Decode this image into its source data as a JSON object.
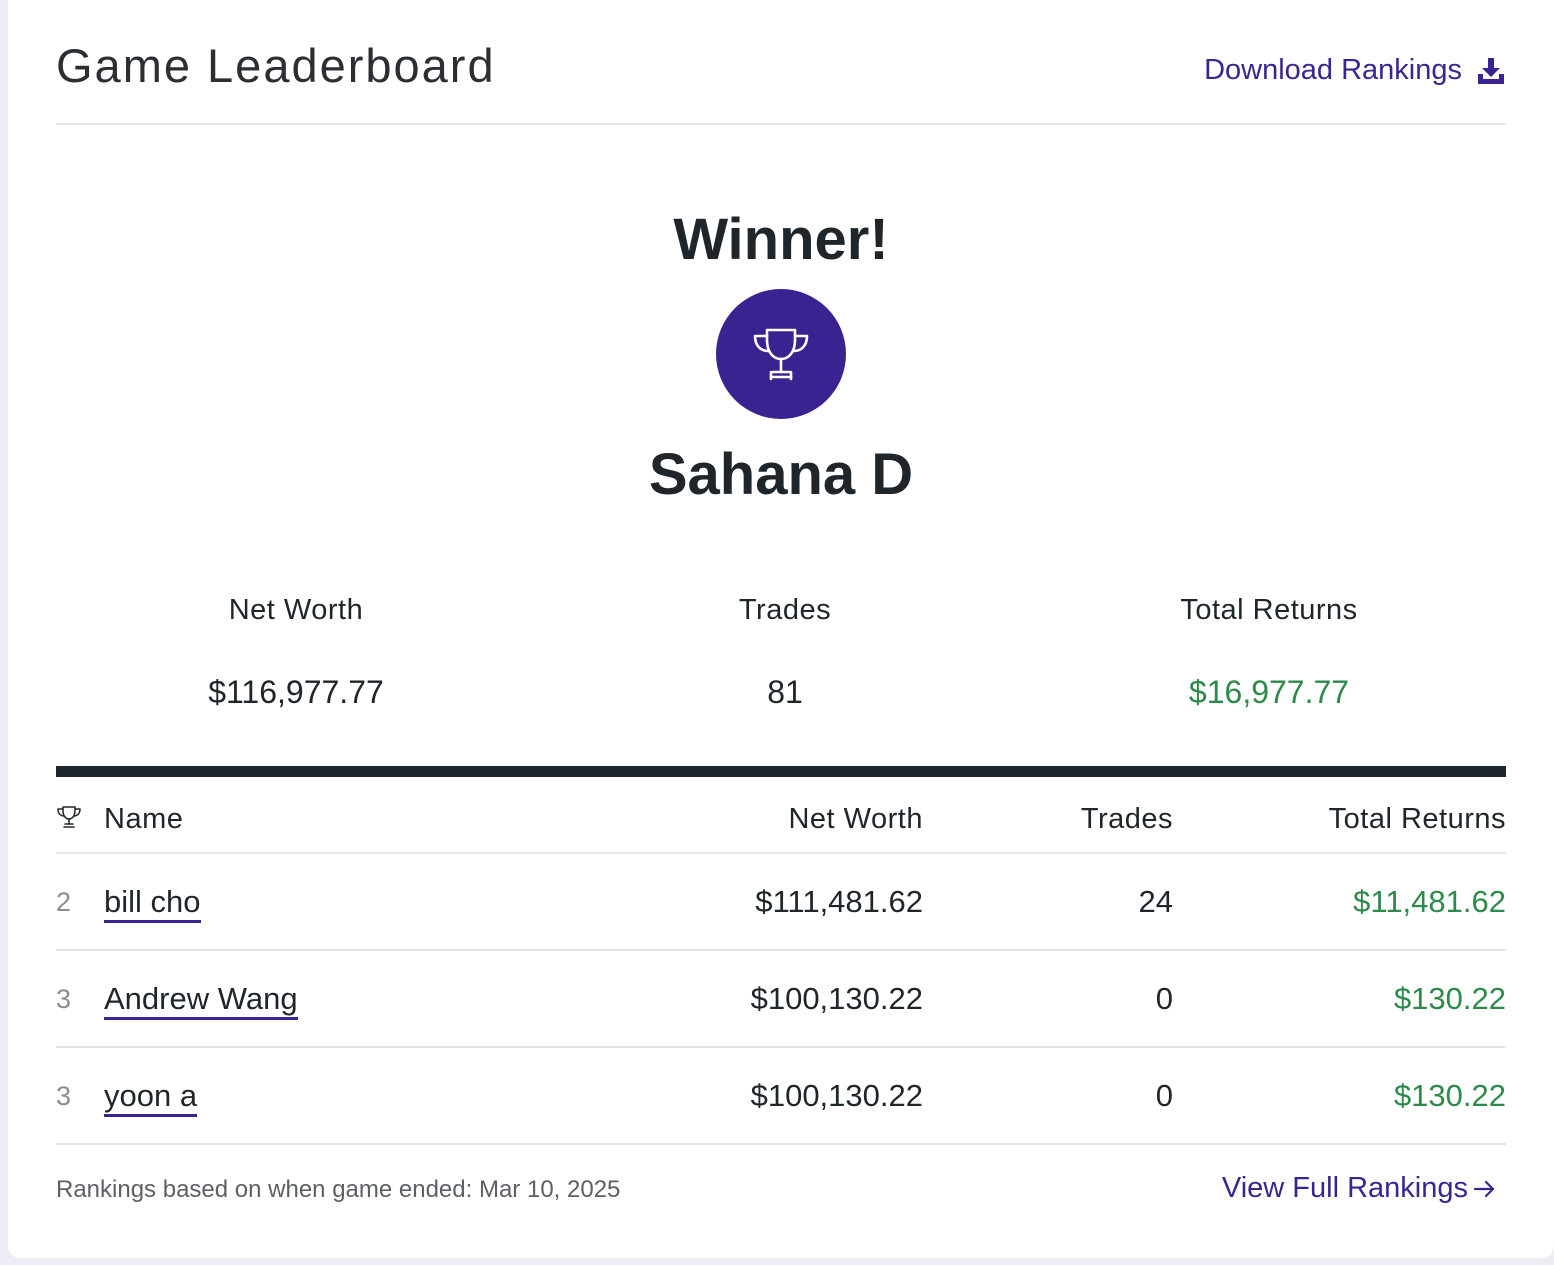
{
  "header": {
    "title": "Game Leaderboard",
    "download_label": "Download Rankings",
    "download_icon": "download-icon"
  },
  "winner": {
    "heading": "Winner!",
    "icon": "trophy-icon",
    "name": "Sahana D",
    "stats": {
      "net_worth_label": "Net Worth",
      "net_worth": "$116,977.77",
      "trades_label": "Trades",
      "trades": "81",
      "returns_label": "Total Returns",
      "returns": "$16,977.77"
    }
  },
  "table": {
    "columns": {
      "rank_icon": "trophy-icon",
      "name": "Name",
      "net_worth": "Net Worth",
      "trades": "Trades",
      "returns": "Total Returns"
    },
    "rows": [
      {
        "rank": "2",
        "name": "bill cho",
        "net_worth": "$111,481.62",
        "trades": "24",
        "returns": "$11,481.62"
      },
      {
        "rank": "3",
        "name": "Andrew Wang",
        "net_worth": "$100,130.22",
        "trades": "0",
        "returns": "$130.22"
      },
      {
        "rank": "3",
        "name": "yoon a",
        "net_worth": "$100,130.22",
        "trades": "0",
        "returns": "$130.22"
      }
    ]
  },
  "footer": {
    "note": "Rankings based on when game ended: Mar 10, 2025",
    "full_rankings_label": "View Full Rankings",
    "arrow_icon": "arrow-right-icon"
  },
  "colors": {
    "accent": "#3b2291",
    "positive": "#2e8a4a",
    "text": "#1f262b"
  }
}
